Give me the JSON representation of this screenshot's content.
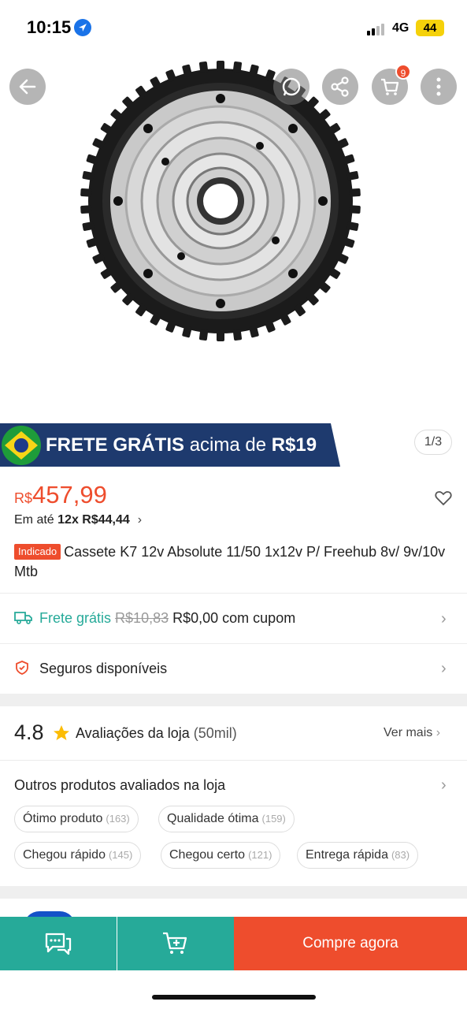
{
  "status_bar": {
    "time": "10:15",
    "network": "4G",
    "battery": "44"
  },
  "hero": {
    "cart_badge": "9",
    "image_counter": "1/3"
  },
  "banner": {
    "frete_bold": "FRETE GRÁTIS",
    "frete_mid": "acima de",
    "frete_amount": "R$19"
  },
  "price": {
    "currency": "R$",
    "value": "457,99",
    "installment_prefix": "Em até",
    "installment_value": "12x R$44,44"
  },
  "product": {
    "tag": "Indicado",
    "title": "Cassete K7 12v Absolute 11/50 1x12v P/ Freehub 8v/ 9v/10v Mtb"
  },
  "shipping": {
    "label": "Frete grátis",
    "old_price": "R$10,83",
    "new_price": "R$0,00 com cupom"
  },
  "insurance": {
    "label": "Seguros disponíveis"
  },
  "rating": {
    "score": "4.8",
    "label": "Avaliações da loja",
    "count": "(50mil)",
    "see_more": "Ver mais"
  },
  "reviews": {
    "title": "Outros produtos avaliados na loja",
    "chips": [
      {
        "label": "Ótimo produto",
        "count": "(163)"
      },
      {
        "label": "Qualidade ótima",
        "count": "(159)"
      },
      {
        "label": "Chegou rápido",
        "count": "(145)"
      },
      {
        "label": "Chegou certo",
        "count": "(121)"
      },
      {
        "label": "Entrega rápida",
        "count": "(83)"
      }
    ]
  },
  "bottom_bar": {
    "buy_label": "Compre agora"
  },
  "colors": {
    "brand": "#ee4d2d",
    "teal": "#26aa99",
    "banner": "#1e3a6e"
  },
  "icons": [
    "location-arrow-icon",
    "back-icon",
    "whatsapp-icon",
    "share-icon",
    "cart-icon",
    "more-icon",
    "heart-icon",
    "truck-icon",
    "shield-icon",
    "star-icon",
    "chevron-right-icon",
    "chat-icon",
    "add-to-cart-icon"
  ]
}
